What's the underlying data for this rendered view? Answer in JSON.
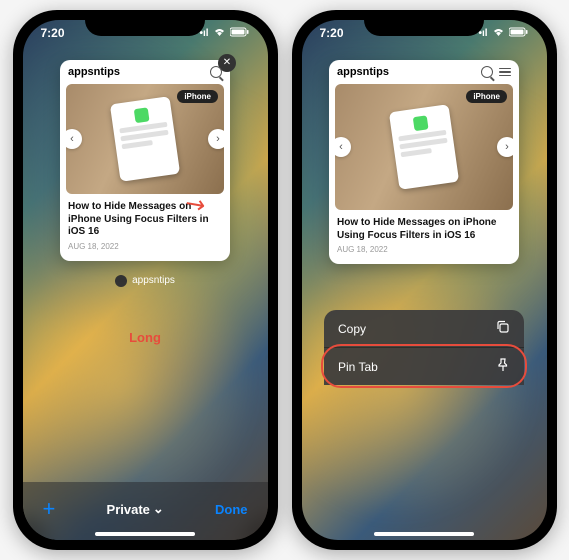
{
  "statusbar": {
    "time": "7:20",
    "signal": "••••",
    "wifi": "wifi",
    "battery": "batt"
  },
  "tab": {
    "site_name": "appsntips",
    "category_pill": "iPhone",
    "article_title": "How to Hide Messages on iPhone Using Focus Filters in iOS 16",
    "article_date": "AUG 18, 2022",
    "label": "appsntips"
  },
  "annotations": {
    "left_label": "Long"
  },
  "bottom_bar": {
    "group_label": "Private",
    "done_label": "Done"
  },
  "context_menu": {
    "items": [
      {
        "label": "Copy",
        "icon": "copy-icon"
      },
      {
        "label": "Pin Tab",
        "icon": "pin-icon"
      }
    ]
  }
}
